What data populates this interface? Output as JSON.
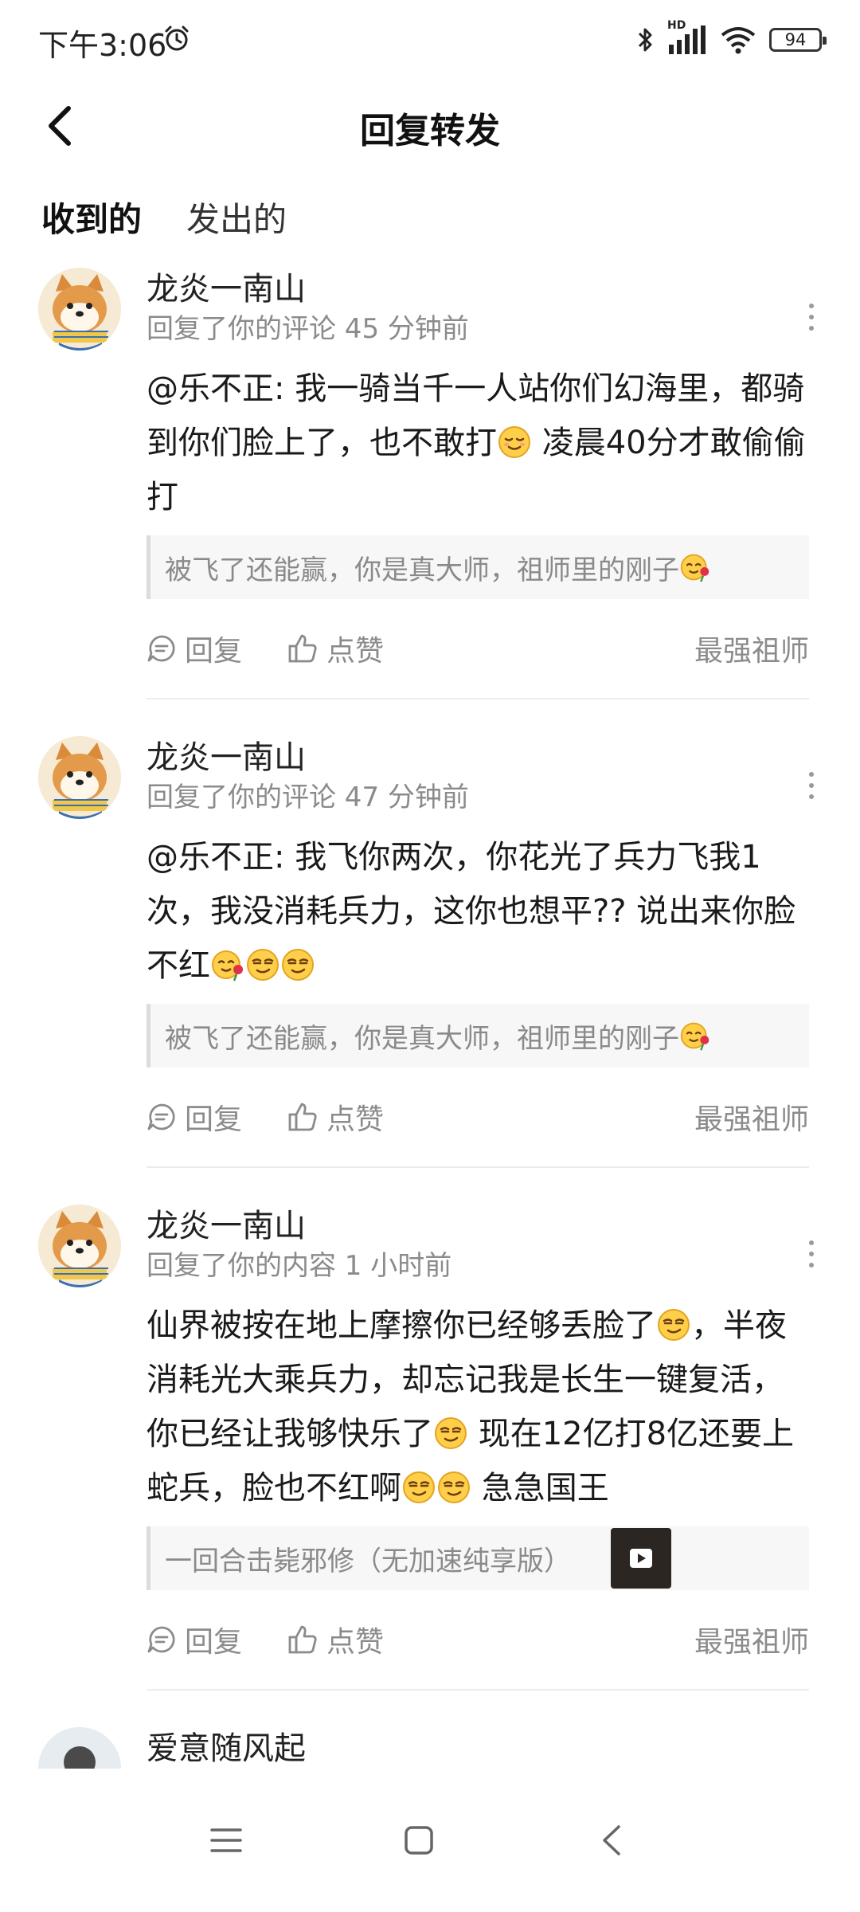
{
  "status_bar": {
    "time": "下午3:06",
    "network": "HD",
    "battery": "94"
  },
  "header": {
    "title": "回复转发"
  },
  "tabs": [
    {
      "label": "收到的",
      "active": true
    },
    {
      "label": "发出的",
      "active": false
    }
  ],
  "items": [
    {
      "user": "龙炎一南山",
      "meta": "回复了你的评论 45 分钟前",
      "text_parts": [
        "@乐不正: 我一骑当千一人站你们幻海里，都骑到你们脸上了，也不敢打",
        " 凌晨40分才敢偷偷打"
      ],
      "quote": "被飞了还能赢，你是真大师，祖师里的刚子",
      "reply_label": "回复",
      "like_label": "点赞",
      "author_tag": "最强祖师"
    },
    {
      "user": "龙炎一南山",
      "meta": "回复了你的评论 47 分钟前",
      "text_parts": [
        "@乐不正: 我飞你两次，你花光了兵力飞我1次，我没消耗兵力，这你也想平?? 说出来你脸不红"
      ],
      "quote": "被飞了还能赢，你是真大师，祖师里的刚子",
      "reply_label": "回复",
      "like_label": "点赞",
      "author_tag": "最强祖师"
    },
    {
      "user": "龙炎一南山",
      "meta": "回复了你的内容 1 小时前",
      "text_parts": [
        "仙界被按在地上摩擦你已经够丢脸了",
        "，半夜消耗光大乘兵力，却忘记我是长生一键复活，你已经让我够快乐了",
        " 现在12亿打8亿还要上蛇兵，脸也不红啊",
        " 急急国王"
      ],
      "quote": "一回合击毙邪修（无加速纯享版）",
      "reply_label": "回复",
      "like_label": "点赞",
      "author_tag": "最强祖师"
    },
    {
      "user": "爱意随风起"
    }
  ],
  "icons": {
    "emoji": "grinning-smile-emoji",
    "reply": "comment-bubble-icon",
    "like": "thumbs-up-icon"
  },
  "colors": {
    "accent": "#2ad1c2",
    "muted_text": "#8b8b8b"
  }
}
